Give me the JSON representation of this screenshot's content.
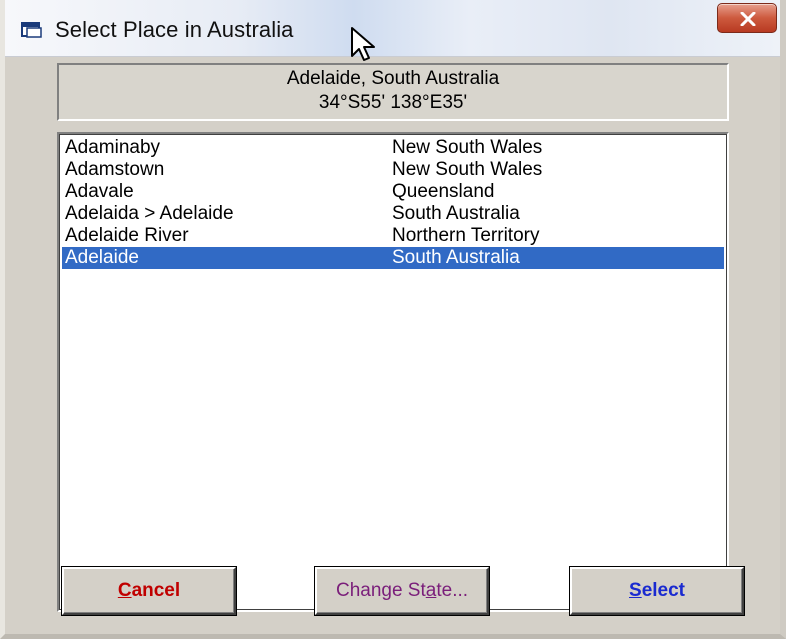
{
  "window": {
    "title": "Select Place in Australia",
    "close_label": "x"
  },
  "info": {
    "place": "Adelaide, South Australia",
    "coords": "34°S55'  138°E35'"
  },
  "list": {
    "selected_index": 5,
    "items": [
      {
        "name": "Adaminaby",
        "state": "New South Wales"
      },
      {
        "name": "Adamstown",
        "state": "New South Wales"
      },
      {
        "name": "Adavale",
        "state": "Queensland"
      },
      {
        "name": "Adelaida > Adelaide",
        "state": "South Australia"
      },
      {
        "name": "Adelaide River",
        "state": "Northern Territory"
      },
      {
        "name": "Adelaide",
        "state": "South Australia"
      }
    ]
  },
  "buttons": {
    "cancel": {
      "mnemonic": "C",
      "rest": "ancel"
    },
    "change_state": {
      "before": "Change St",
      "mnemonic": "a",
      "after": "te..."
    },
    "select": {
      "mnemonic": "S",
      "rest": "elect"
    }
  },
  "icons": {
    "window": "window-icon",
    "close": "close-icon",
    "cursor": "mouse-cursor-icon"
  },
  "colors": {
    "selection": "#316ac5",
    "cancel_text": "#c00000",
    "change_text": "#7a1e7a",
    "select_text": "#1a2ad0",
    "close_button": "#cd5a3e"
  }
}
